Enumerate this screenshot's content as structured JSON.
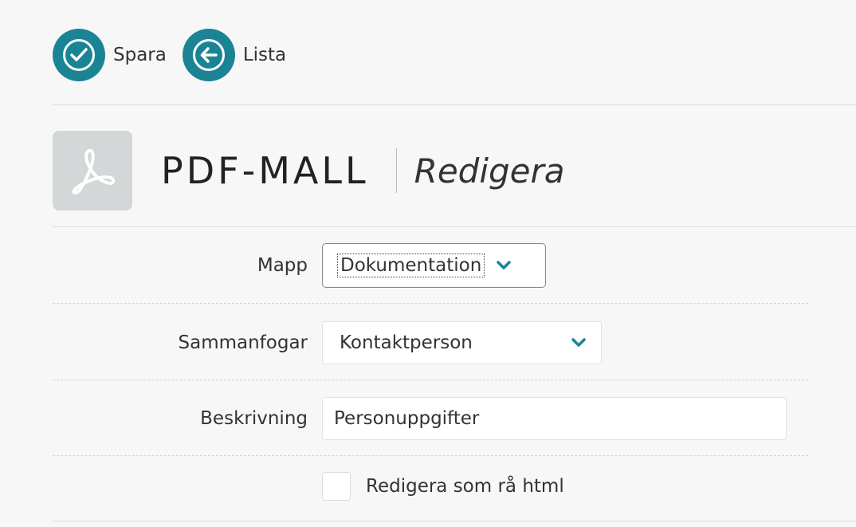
{
  "toolbar": {
    "save_label": "Spara",
    "list_label": "Lista",
    "accent_color": "#1b8494"
  },
  "header": {
    "icon": "pdf-icon",
    "title": "PDF-MALL",
    "subtitle": "Redigera"
  },
  "form": {
    "folder": {
      "label": "Mapp",
      "value": "Dokumentation"
    },
    "merge": {
      "label": "Sammanfogar",
      "value": "Kontaktperson"
    },
    "description": {
      "label": "Beskrivning",
      "value": "Personuppgifter"
    },
    "raw_html": {
      "label": "Redigera som rå html",
      "checked": false
    }
  }
}
